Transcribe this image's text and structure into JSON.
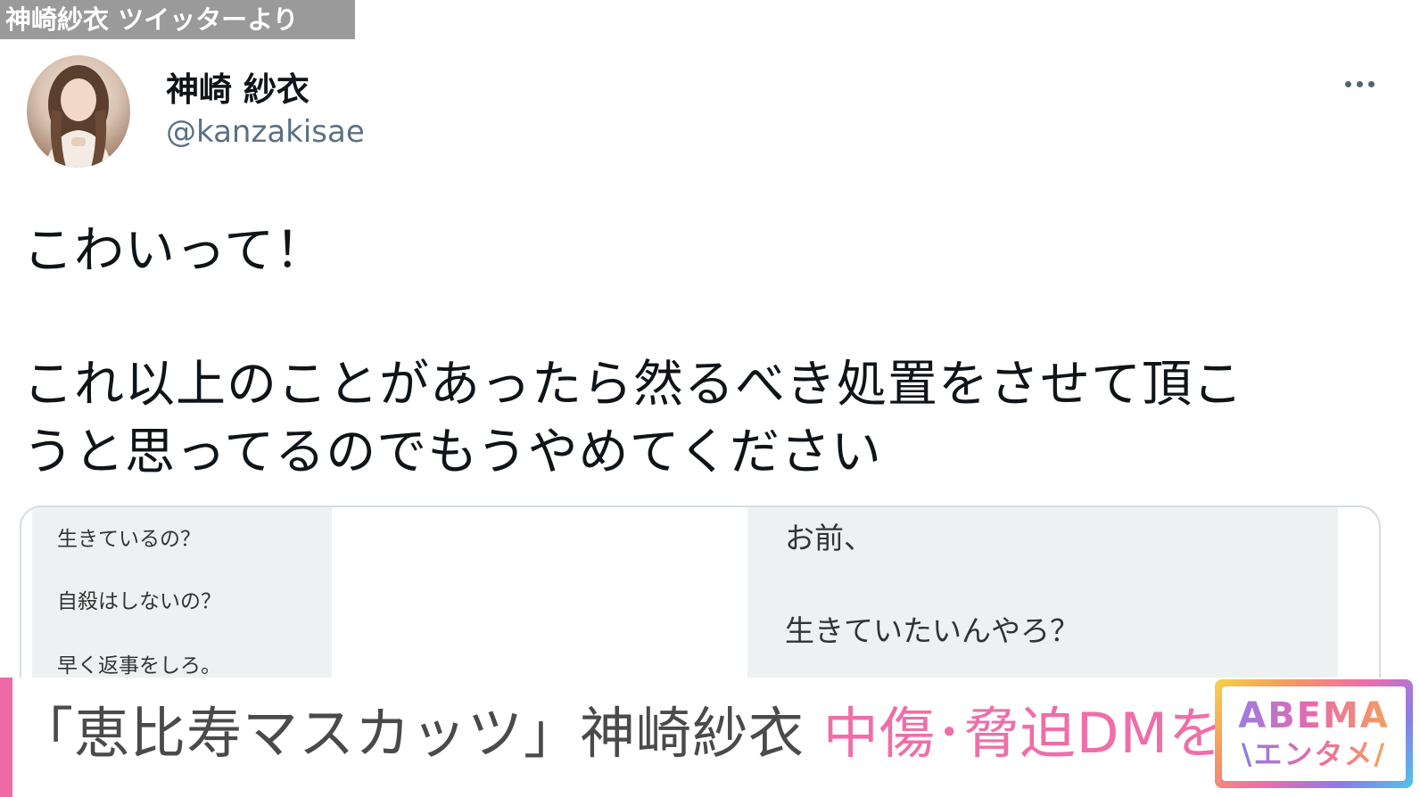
{
  "source_tag": "神崎紗衣 ツイッターより",
  "tweet": {
    "display_name": "神崎 紗衣",
    "handle": "@kanzakisae",
    "more_icon": "more-horizontal-icon",
    "text_lines": [
      "こわいって！",
      "これ以上のことがあったら然るべき処置をさせて頂こ",
      "うと思ってるのでもうやめてください"
    ]
  },
  "dm_left": [
    "生きているの？",
    "自殺はしないの？",
    "早く返事をしろ。"
  ],
  "dm_right": [
    "お前、",
    "生きていたいんやろ？"
  ],
  "caption": {
    "main": "「恵比寿マスカッツ」神崎紗衣",
    "highlight": "中傷･脅迫DMを公開",
    "highlight_color": "#ef6ea8"
  },
  "logo": {
    "top": "ABEMA",
    "bottom": "\\エンタメ/"
  }
}
